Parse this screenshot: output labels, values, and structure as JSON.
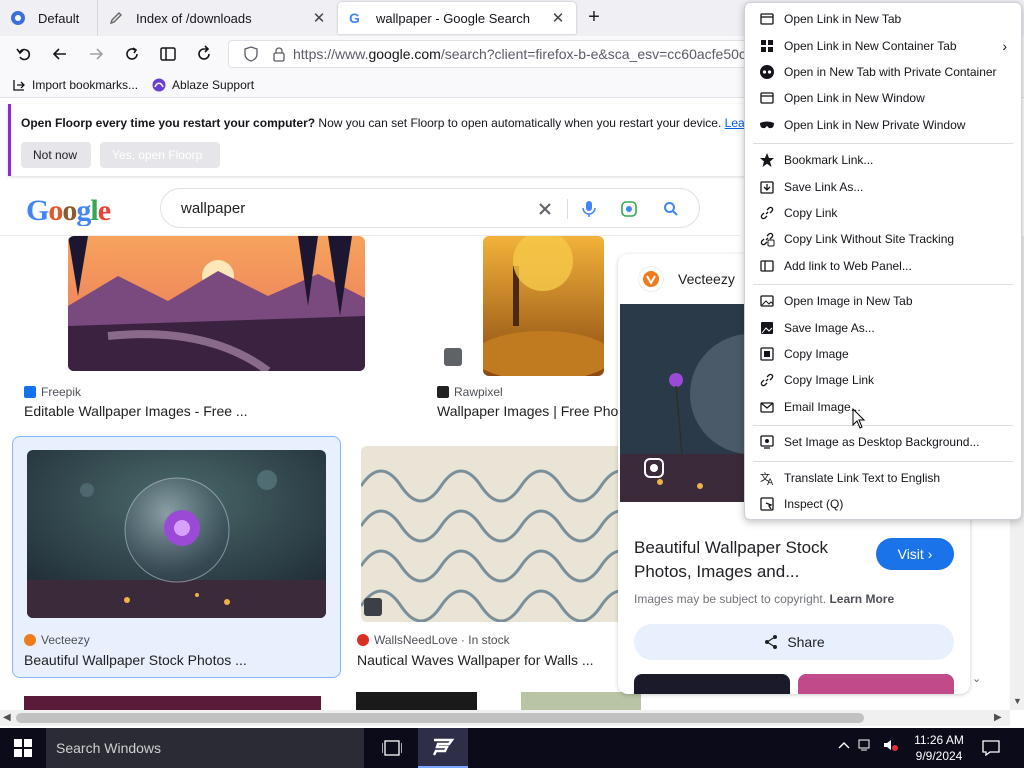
{
  "tabs": [
    {
      "title": "Default"
    },
    {
      "title": "Index of /downloads"
    },
    {
      "title": "wallpaper - Google Search"
    }
  ],
  "urlbar": {
    "prefix": "https://www.",
    "host": "google.com",
    "path": "/search?client=firefox-b-e&sca_esv=cc60acfe50cff"
  },
  "bookmarks": [
    {
      "label": "Import bookmarks..."
    },
    {
      "label": "Ablaze Support"
    }
  ],
  "notification": {
    "bold": "Open Floorp every time you restart your computer?",
    "text": " Now you can set Floorp to open automatically when you restart your device.",
    "link": "Learn",
    "btn_no": "Not now",
    "btn_yes": "Yes, open Floorp"
  },
  "google": {
    "logo": "Google",
    "query": "wallpaper"
  },
  "results": [
    {
      "source": "Freepik",
      "title": "Editable Wallpaper Images - Free ..."
    },
    {
      "source": "Rawpixel",
      "title": "Wallpaper Images | Free Pho"
    },
    {
      "source": "Vecteezy",
      "title": "Beautiful Wallpaper Stock Photos ..."
    },
    {
      "source": "WallsNeedLove · In stock",
      "title": "Nautical Waves Wallpaper for Walls ..."
    }
  ],
  "side_panel": {
    "source": "Vecteezy",
    "title": "Beautiful Wallpaper Stock Photos, Images and...",
    "visit": "Visit",
    "copyright": "Images may be subject to copyright.",
    "learn_more": "Learn More",
    "share": "Share"
  },
  "context_menu": {
    "items": [
      {
        "label": "Open Link in New Tab",
        "icon": "new-tab-icon"
      },
      {
        "label": "Open Link in New Container Tab",
        "icon": "container-icon",
        "submenu": true
      },
      {
        "label": "Open in New Tab with Private Container",
        "icon": "private-container-icon"
      },
      {
        "label": "Open Link in New Window",
        "icon": "window-icon"
      },
      {
        "label": "Open Link in New Private Window",
        "icon": "private-mask-icon"
      },
      {
        "label": "Bookmark Link...",
        "icon": "star-icon"
      },
      {
        "label": "Save Link As...",
        "icon": "save-icon"
      },
      {
        "label": "Copy Link",
        "icon": "link-icon"
      },
      {
        "label": "Copy Link Without Site Tracking",
        "icon": "clean-link-icon"
      },
      {
        "label": "Add link to Web Panel...",
        "icon": "web-panel-icon"
      },
      {
        "label": "Open Image in New Tab",
        "icon": "image-tab-icon"
      },
      {
        "label": "Save Image As...",
        "icon": "image-save-icon"
      },
      {
        "label": "Copy Image",
        "icon": "image-copy-icon"
      },
      {
        "label": "Copy Image Link",
        "icon": "link-icon"
      },
      {
        "label": "Email Image...",
        "icon": "mail-icon"
      },
      {
        "label": "Set Image as Desktop Background...",
        "icon": "desktop-icon"
      },
      {
        "label": "Translate Link Text to English",
        "icon": "translate-icon"
      },
      {
        "label": "Inspect (Q)",
        "icon": "inspect-icon"
      }
    ]
  },
  "taskbar": {
    "search_placeholder": "Search Windows",
    "time": "11:26 AM",
    "date": "9/9/2024"
  },
  "colors": {
    "accent": "#8f2ad6",
    "google_blue": "#1a73e8",
    "selection": "#e8f0fe"
  }
}
